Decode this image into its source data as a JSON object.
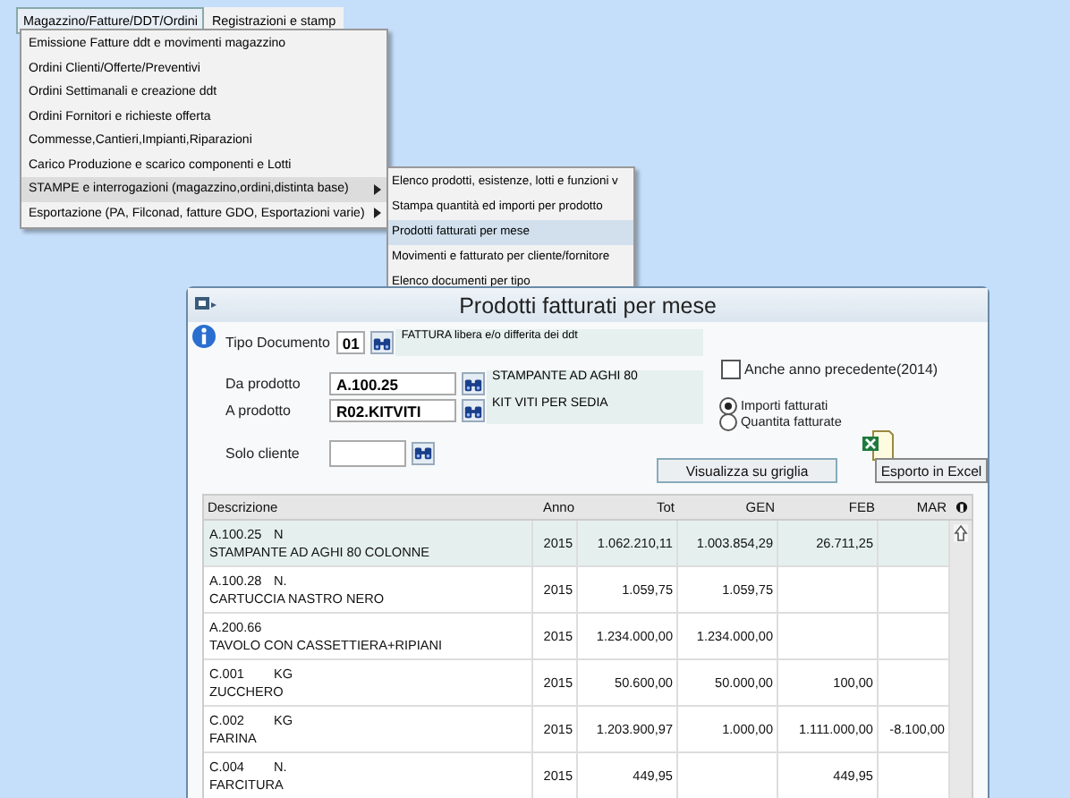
{
  "menubar": [
    {
      "label": "Magazzino/Fatture/DDT/Ordini",
      "selected": true
    },
    {
      "label": "Registrazioni e stamp",
      "selected": false
    }
  ],
  "menu": [
    {
      "label": "Emissione Fatture ddt e movimenti magazzino",
      "submenu": false,
      "selected": false
    },
    {
      "label": "Ordini Clienti/Offerte/Preventivi",
      "submenu": false,
      "selected": false
    },
    {
      "label": "Ordini Settimanali e creazione ddt",
      "submenu": false,
      "selected": false
    },
    {
      "label": "Ordini Fornitori e richieste offerta",
      "submenu": false,
      "selected": false
    },
    {
      "label": "Commesse,Cantieri,Impianti,Riparazioni",
      "submenu": false,
      "selected": false
    },
    {
      "label": "Carico Produzione e scarico componenti e Lotti",
      "submenu": false,
      "selected": false
    },
    {
      "label": "STAMPE e interrogazioni (magazzino,ordini,distinta base)",
      "submenu": true,
      "selected": true
    },
    {
      "label": "Esportazione (PA, Filconad, fatture GDO, Esportazioni varie)",
      "submenu": true,
      "selected": false
    }
  ],
  "submenu": [
    {
      "label": "Elenco prodotti, esistenze, lotti e funzioni v",
      "selected": false
    },
    {
      "label": "Stampa quantità ed importi per prodotto",
      "selected": false
    },
    {
      "label": "Prodotti fatturati per mese",
      "selected": true
    },
    {
      "label": "Movimenti e fatturato per cliente/fornitore",
      "selected": false
    },
    {
      "label": "Elenco documenti per tipo",
      "selected": false
    }
  ],
  "window": {
    "title": "Prodotti fatturati per mese"
  },
  "form": {
    "doc_type": {
      "label": "Tipo Documento",
      "value": "01",
      "description": "FATTURA libera e/o differita dei ddt"
    },
    "from_product": {
      "label": "Da prodotto",
      "value": "A.100.25",
      "description": "STAMPANTE AD AGHI 80"
    },
    "to_product": {
      "label": "A prodotto",
      "value": "R02.KITVITI",
      "description": "KIT VITI PER SEDIA"
    },
    "only_client": {
      "label": "Solo cliente"
    },
    "previous_year": {
      "label": "Anche anno precedente(2014)",
      "checked": false
    },
    "options": [
      {
        "label": "Importi fatturati",
        "selected": true
      },
      {
        "label": "Quantita fatturate",
        "selected": false
      }
    ],
    "show_button": "Visualizza su griglia",
    "excel_button": "Esporto in Excel"
  },
  "table": {
    "columns": [
      "Descrizione",
      "Anno",
      "Tot",
      "GEN",
      "FEB",
      "MAR"
    ],
    "rows": [
      {
        "cells": [
          {
            "code": "A.100.25",
            "unit": "N",
            "name": "STAMPANTE AD AGHI 80 COLONNE"
          },
          "2015",
          "1.062.210,11",
          "1.003.854,29",
          "26.711,25",
          ""
        ],
        "selected": true
      },
      {
        "cells": [
          {
            "code": "A.100.28",
            "unit": "N.",
            "name": "CARTUCCIA NASTRO NERO"
          },
          "2015",
          "1.059,75",
          "1.059,75",
          "",
          ""
        ],
        "selected": false
      },
      {
        "cells": [
          {
            "code": "A.200.66",
            "name": "TAVOLO CON CASSETTIERA+RIPIANI"
          },
          "2015",
          "1.234.000,00",
          "1.234.000,00",
          "",
          ""
        ],
        "selected": false
      },
      {
        "cells": [
          {
            "code": "C.001",
            "unit": "KG",
            "name": "ZUCCHERO"
          },
          "2015",
          "50.600,00",
          "50.000,00",
          "100,00",
          ""
        ],
        "selected": false
      },
      {
        "cells": [
          {
            "code": "C.002",
            "unit": "KG",
            "name": "FARINA"
          },
          "2015",
          "1.203.900,97",
          "1.000,00",
          "1.111.000,00",
          "-8.100,00"
        ],
        "selected": false
      },
      {
        "cells": [
          {
            "code": "C.004",
            "unit": "N.",
            "name": "FARCITURA"
          },
          "2015",
          "449,95",
          "",
          "449,95",
          ""
        ],
        "selected": false
      }
    ]
  }
}
